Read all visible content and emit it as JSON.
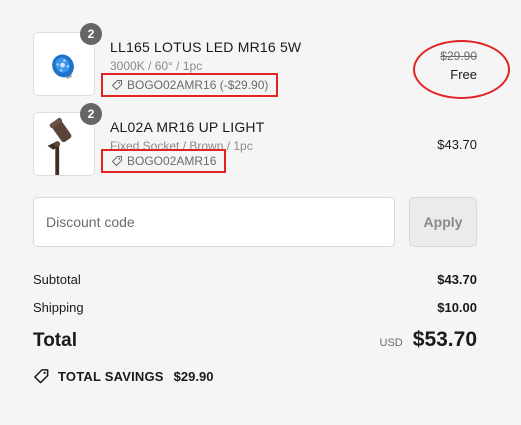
{
  "line_items": [
    {
      "quantity": "2",
      "title": "LL165 LOTUS LED MR16 5W",
      "variant": "3000K / 60° / 1pc",
      "discount": "BOGO02AMR16 (-$29.90)",
      "original_price": "$29.90",
      "final_price": "Free",
      "image_icon": "blue-led-bulb"
    },
    {
      "quantity": "2",
      "title": "AL02A MR16 UP LIGHT",
      "variant": "Fixed Socket / Brown / 1pc",
      "discount": "BOGO02AMR16",
      "final_price": "$43.70",
      "image_icon": "brown-spot-light"
    }
  ],
  "discount_code": {
    "placeholder": "Discount code",
    "apply_label": "Apply"
  },
  "summary": {
    "subtotal_label": "Subtotal",
    "subtotal_value": "$43.70",
    "shipping_label": "Shipping",
    "shipping_value": "$10.00",
    "total_label": "Total",
    "currency": "USD",
    "total_value": "$53.70",
    "savings_label": "TOTAL SAVINGS",
    "savings_value": "$29.90"
  },
  "colors": {
    "annotation_red": "#e02424",
    "background": "#f5f5f5"
  }
}
